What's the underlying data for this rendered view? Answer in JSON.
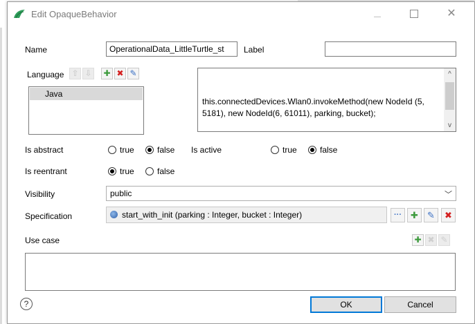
{
  "window": {
    "title": "Edit OpaqueBehavior"
  },
  "fields": {
    "name_label": "Name",
    "name_value": "OperationalData_LittleTurtle_st",
    "label_label": "Label",
    "label_value": "",
    "language_label": "Language",
    "languages": [
      "Java"
    ],
    "code_text": "this.connectedDevices.Wlan0.invokeMethod(new NodeId (5, 5181), new NodeId(6, 61011), parking, bucket);",
    "is_abstract_label": "Is abstract",
    "is_active_label": "Is active",
    "is_reentrant_label": "Is reentrant",
    "true_label": "true",
    "false_label": "false",
    "is_abstract": false,
    "is_active": false,
    "is_reentrant": true,
    "visibility_label": "Visibility",
    "visibility_value": "public",
    "specification_label": "Specification",
    "specification_value": "start_with_init (parking : Integer, bucket : Integer)",
    "use_case_label": "Use case"
  },
  "icons": {
    "app": "opaque-behavior-icon",
    "add": "plus-icon",
    "delete": "cross-icon",
    "edit": "pencil-icon",
    "browse": "ellipsis-icon",
    "help": "help-icon"
  },
  "buttons": {
    "ok": "OK",
    "cancel": "Cancel"
  },
  "colors": {
    "add": "#3c9a3c",
    "delete": "#d42020",
    "edit": "#3a6fc4",
    "default_button_border": "#0078d7"
  }
}
